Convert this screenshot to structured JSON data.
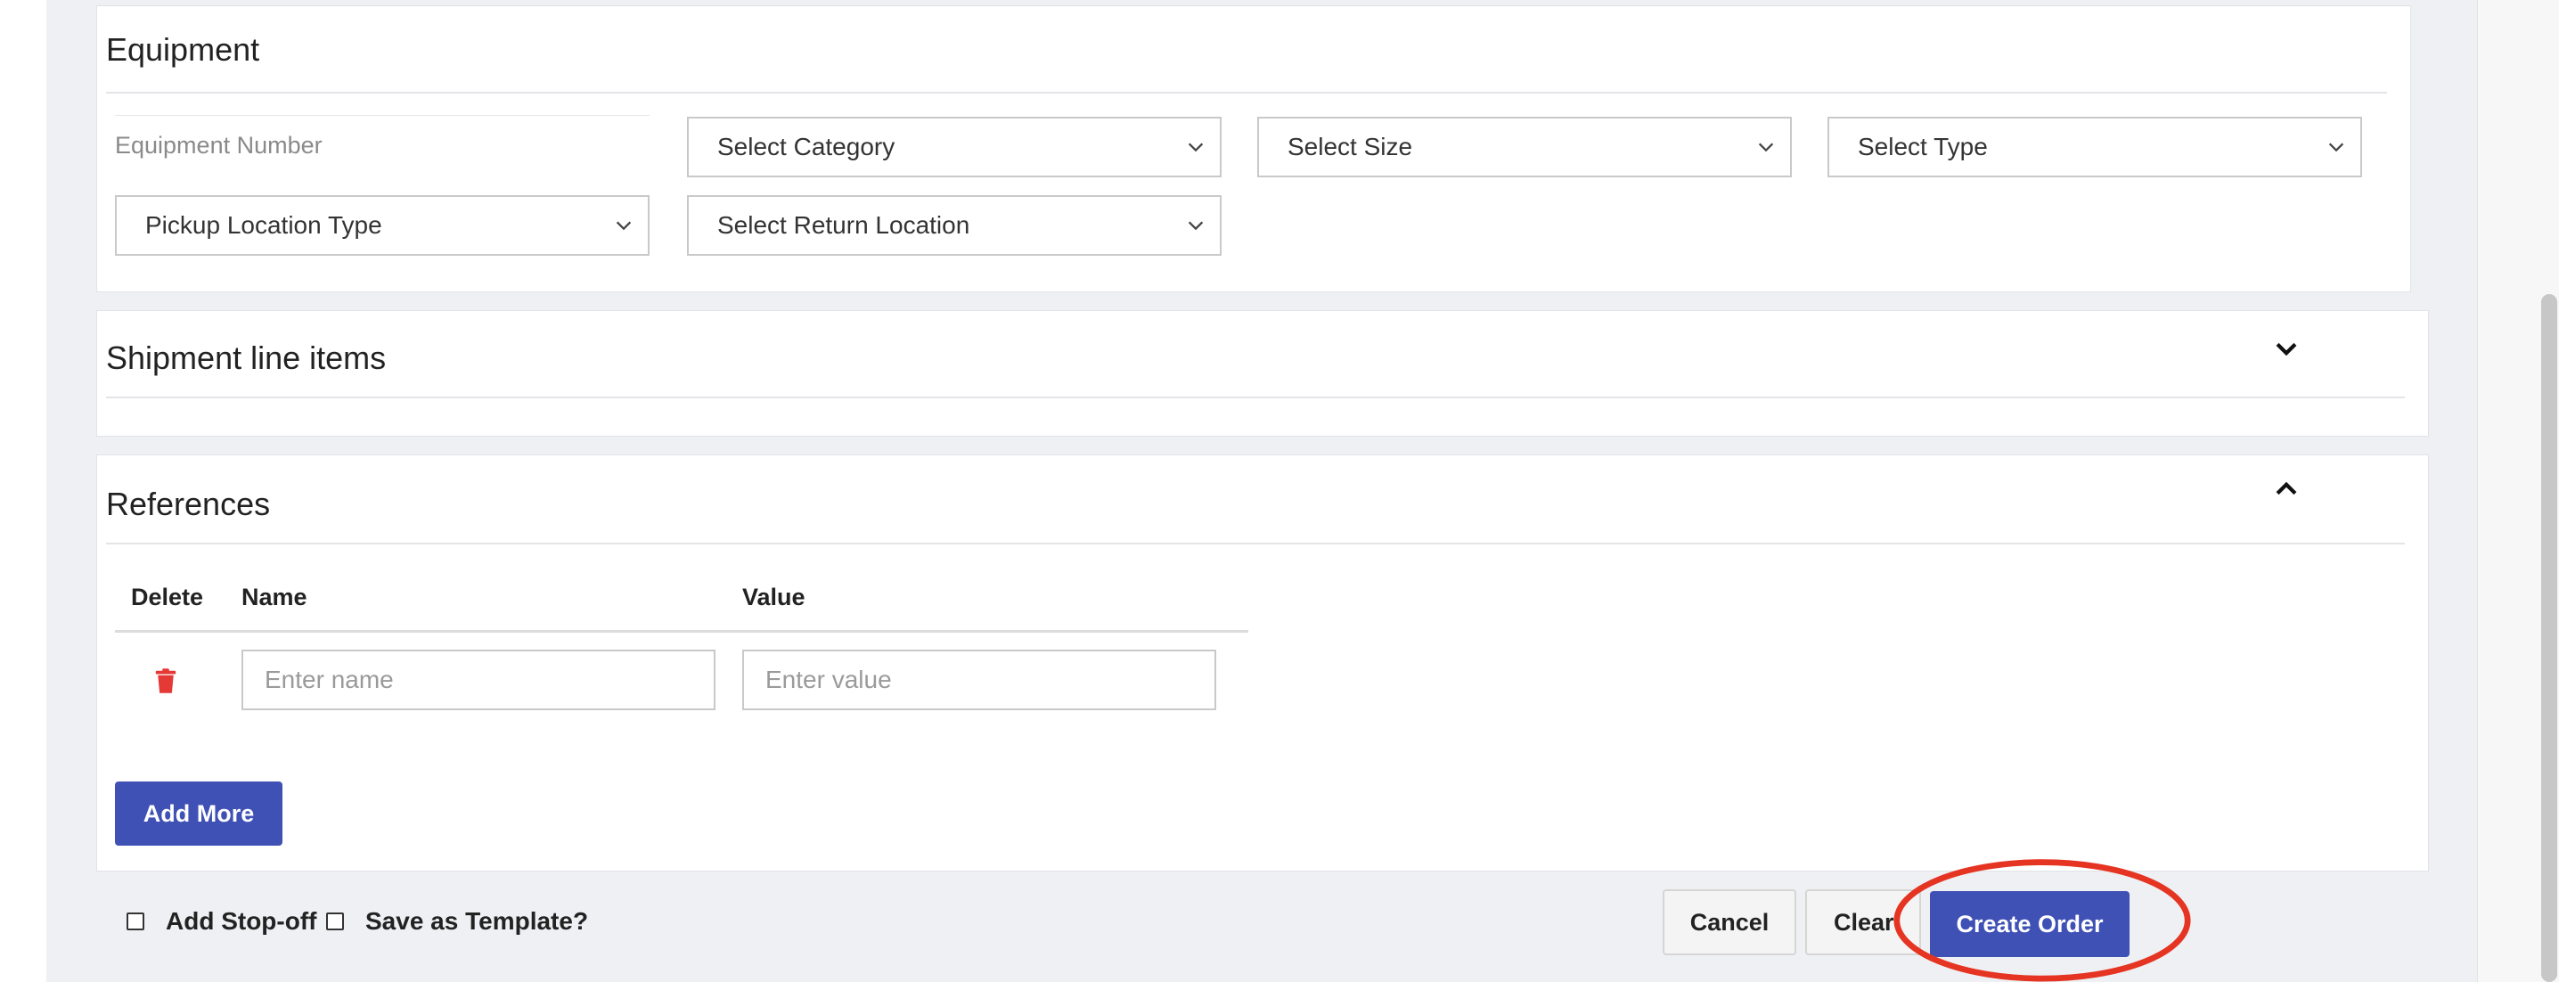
{
  "equipment": {
    "title": "Equipment",
    "equipment_number_placeholder": "Equipment Number",
    "category": "Select Category",
    "size": "Select Size",
    "type": "Select Type",
    "pickup_location_type": "Pickup Location Type",
    "return_location": "Select Return Location"
  },
  "shipment": {
    "title": "Shipment line items",
    "state": "collapsed"
  },
  "references": {
    "title": "References",
    "state": "expanded",
    "columns": [
      "Delete",
      "Name",
      "Value"
    ],
    "row": {
      "name_placeholder": "Enter name",
      "value_placeholder": "Enter value"
    },
    "add_more_label": "Add More"
  },
  "footer": {
    "add_stop_off_label": "Add Stop-off",
    "save_template_label": "Save as Template?",
    "cancel_label": "Cancel",
    "clear_label": "Clear",
    "create_order_label": "Create Order"
  },
  "colors": {
    "primary": "#3f51b5",
    "delete_icon": "#e53935",
    "highlight": "#e53422"
  }
}
